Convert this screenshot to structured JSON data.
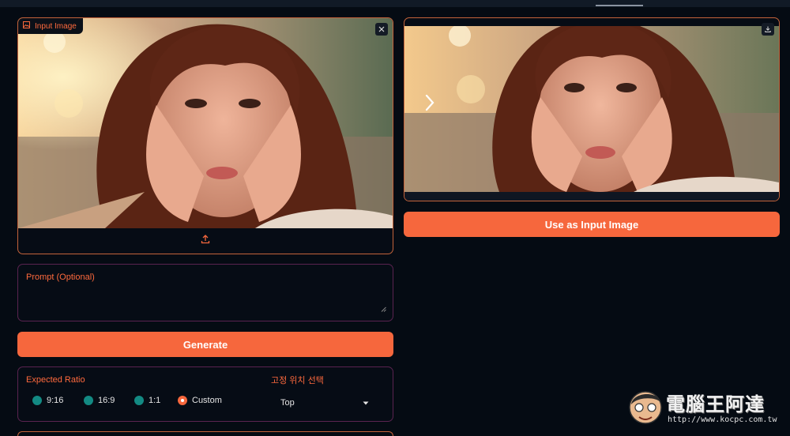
{
  "input_panel": {
    "badge_label": "Input Image",
    "badge_icon": "image-icon",
    "close_icon": "close-icon",
    "upload_icon": "upload-icon"
  },
  "output_panel": {
    "download_icon": "download-icon",
    "nav_icon": "chevron-right-icon"
  },
  "use_button": {
    "label": "Use as Input Image"
  },
  "prompt": {
    "label": "Prompt (Optional)",
    "value": ""
  },
  "generate_button": {
    "label": "Generate"
  },
  "ratio": {
    "title": "Expected Ratio",
    "options": [
      "9:16",
      "16:9",
      "1:1",
      "Custom"
    ],
    "selected": "Custom"
  },
  "fixed_position": {
    "title": "고정 위치 선택",
    "value": "Top"
  },
  "watermark": {
    "name": "電腦王阿達",
    "url": "http://www.kocpc.com.tw"
  },
  "colors": {
    "accent": "#f6673d",
    "background": "#050b13",
    "radio_idle": "#138a83",
    "panel_border": "#5a2350"
  }
}
